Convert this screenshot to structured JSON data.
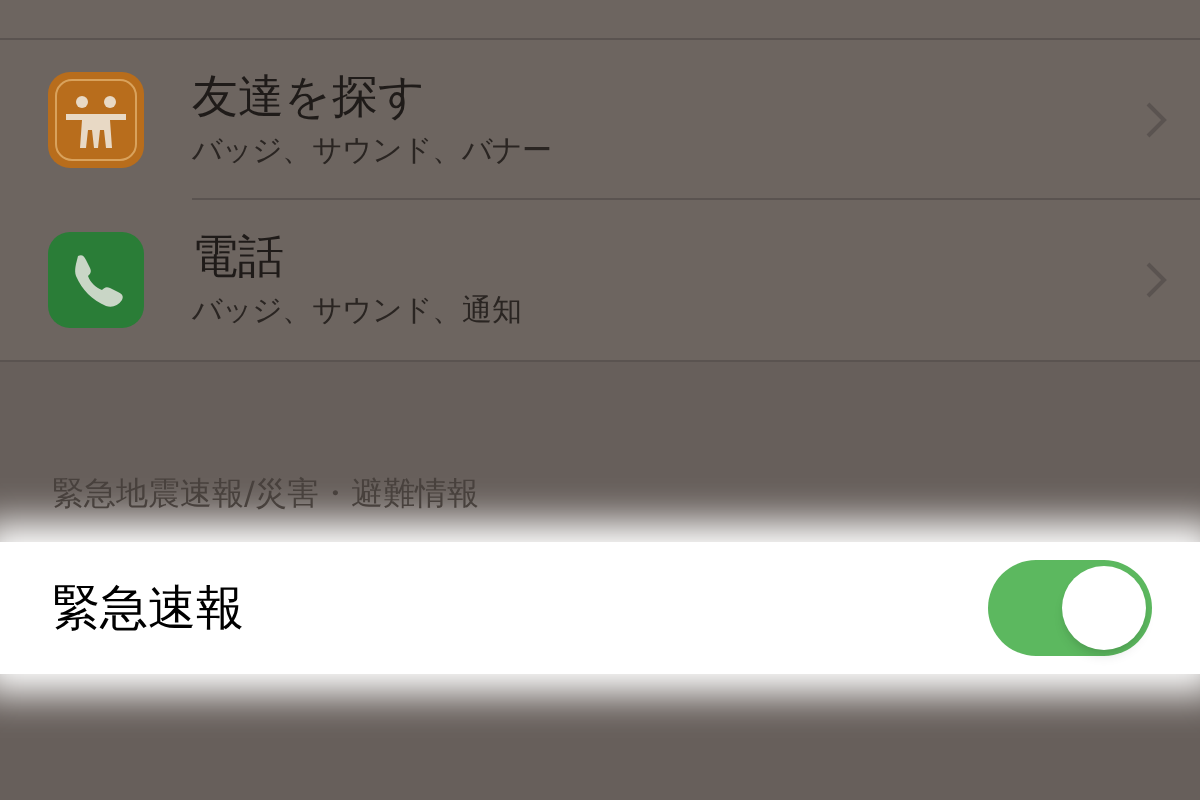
{
  "apps": [
    {
      "kind": "friends",
      "title": "友達を探す",
      "subtitle": "バッジ、サウンド、バナー"
    },
    {
      "kind": "phone",
      "title": "電話",
      "subtitle": "バッジ、サウンド、通知"
    }
  ],
  "section": {
    "header": "緊急地震速報/災害・避難情報",
    "rows": [
      {
        "label": "緊急速報",
        "on": true
      }
    ]
  }
}
